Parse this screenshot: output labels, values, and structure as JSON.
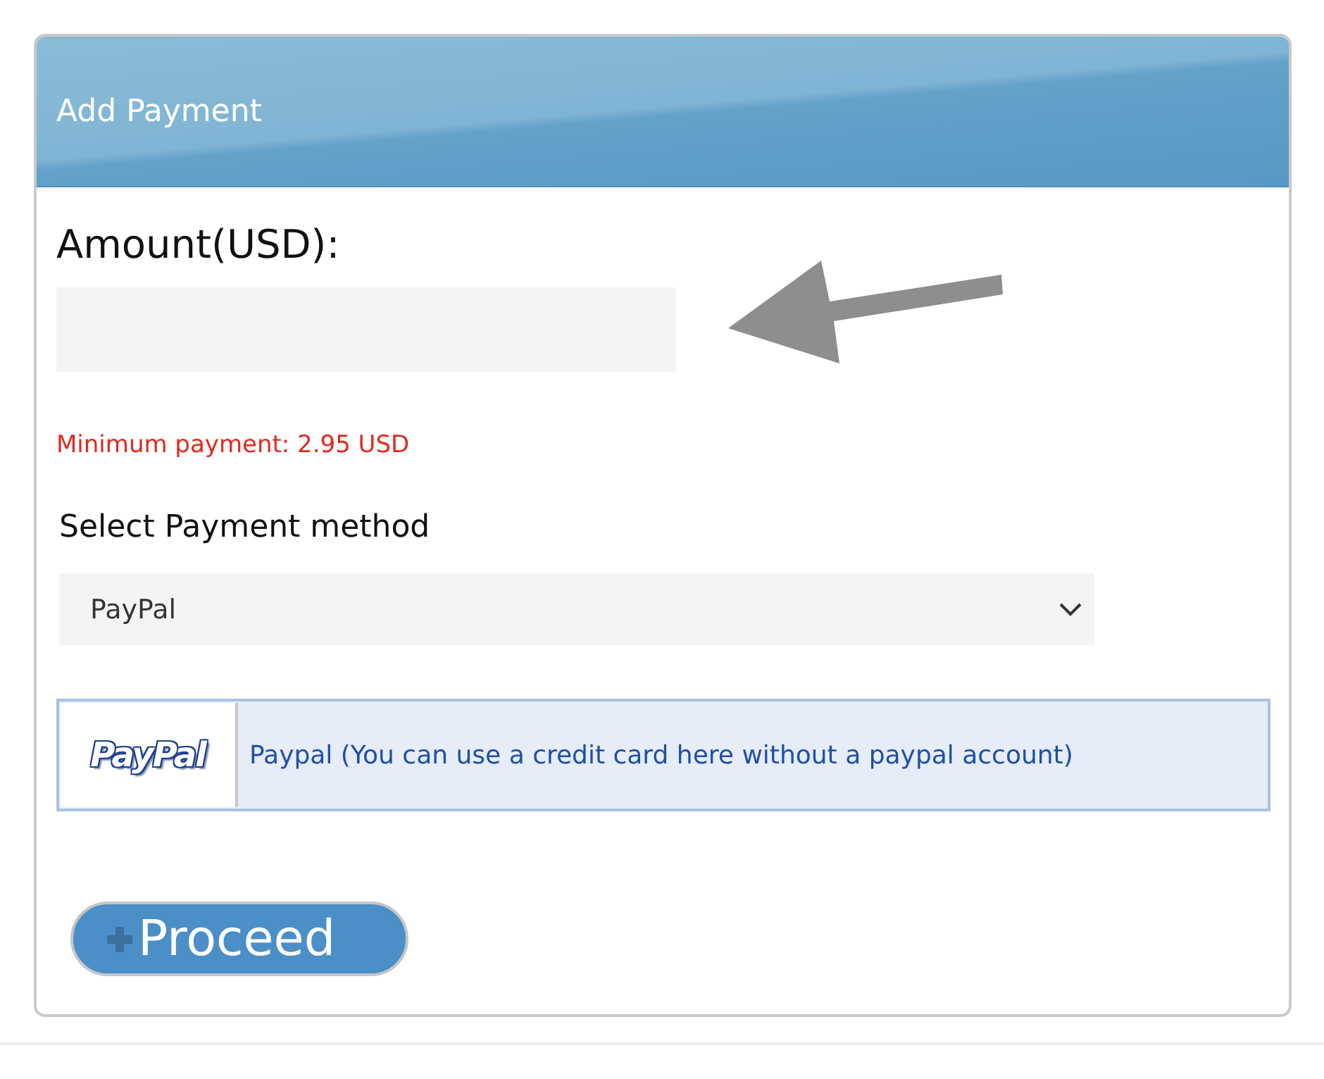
{
  "header": {
    "title": "Add Payment"
  },
  "amount": {
    "label": "Amount(USD):"
  },
  "minimum_note": "Minimum payment: 2.95 USD",
  "method": {
    "label": "Select Payment method",
    "value": "PayPal"
  },
  "payment_option": {
    "logo_text": "PayPal",
    "description": "Paypal (You can use a credit card here without a paypal account)"
  },
  "proceed_button": {
    "label": "Proceed"
  }
}
